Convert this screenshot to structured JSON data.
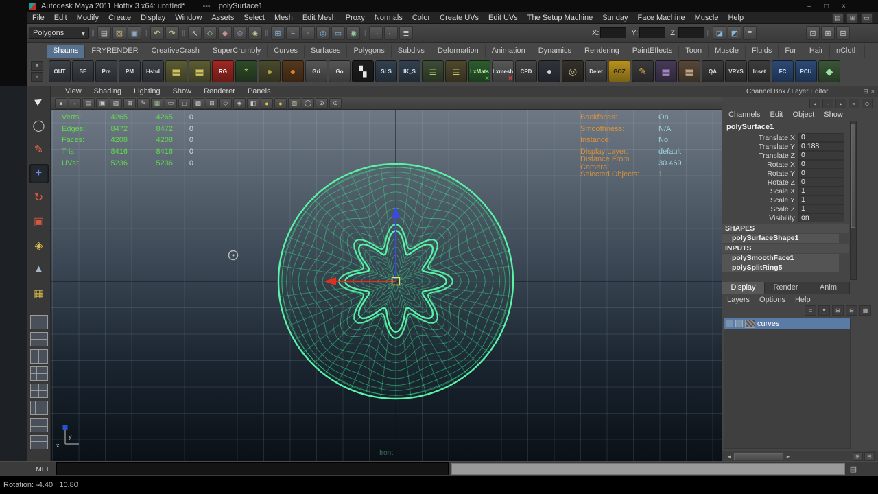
{
  "window": {
    "title": "Autodesk Maya 2011 Hotfix 3 x64: untitled*",
    "selection": "---    polySurface1",
    "controls": [
      {
        "name": "minimize-button",
        "glyph": "–"
      },
      {
        "name": "maximize-button",
        "glyph": "□"
      },
      {
        "name": "close-button",
        "glyph": "×"
      }
    ]
  },
  "menubar": {
    "items": [
      "File",
      "Edit",
      "Modify",
      "Create",
      "Display",
      "Window",
      "Assets",
      "Select",
      "Mesh",
      "Edit Mesh",
      "Proxy",
      "Normals",
      "Color",
      "Create UVs",
      "Edit UVs",
      "The Setup Machine",
      "Sunday",
      "Face Machine",
      "Muscle",
      "Help"
    ],
    "right_icons": [
      {
        "name": "toolbox-toggle-icon",
        "glyph": "▤",
        "color": "#b8b8b8"
      },
      {
        "name": "panel-layout-icon",
        "glyph": "⊞",
        "color": "#b8b8b8"
      },
      {
        "name": "help-line-toggle-icon",
        "glyph": "▭",
        "color": "#b8b8b8"
      }
    ]
  },
  "statusline": {
    "mode": "Polygons",
    "dropdown_arrow": "▾",
    "groups": [
      {
        "name": "scene-group",
        "icons": [
          {
            "name": "new-scene-icon",
            "glyph": "▤",
            "color": "#c8c8c8"
          },
          {
            "name": "open-scene-icon",
            "glyph": "▨",
            "color": "#c8b878"
          },
          {
            "name": "save-scene-icon",
            "glyph": "▣",
            "color": "#88a8c8"
          }
        ]
      },
      {
        "name": "undo-group",
        "icons": [
          {
            "name": "undo-icon",
            "glyph": "↶",
            "color": "#b8d890"
          },
          {
            "name": "redo-icon",
            "glyph": "↷",
            "color": "#b8d890"
          }
        ]
      },
      {
        "name": "selection-mask-group",
        "icons": [
          {
            "name": "select-hierarchy-icon",
            "glyph": "↖",
            "color": "#d8d8d8"
          },
          {
            "name": "select-object-icon",
            "glyph": "◇",
            "color": "#90c890"
          },
          {
            "name": "select-component-icon",
            "glyph": "◆",
            "color": "#c89090"
          },
          {
            "name": "select-by-type-icon",
            "glyph": "⊙",
            "color": "#9090c8"
          },
          {
            "name": "highlight-selection-icon",
            "glyph": "◈",
            "color": "#c8c890"
          }
        ]
      },
      {
        "name": "snap-group",
        "icons": [
          {
            "name": "snap-grid-icon",
            "glyph": "⊞",
            "color": "#7fb2e0"
          },
          {
            "name": "snap-curve-icon",
            "glyph": "≈",
            "color": "#7fb2e0"
          },
          {
            "name": "snap-point-icon",
            "glyph": "∙",
            "color": "#7fb2e0"
          },
          {
            "name": "snap-projected-center-icon",
            "glyph": "◎",
            "color": "#7fb2e0"
          },
          {
            "name": "snap-view-plane-icon",
            "glyph": "▭",
            "color": "#7fb2e0"
          },
          {
            "name": "make-live-icon",
            "glyph": "◉",
            "color": "#90c8a0"
          }
        ]
      },
      {
        "name": "history-group",
        "icons": [
          {
            "name": "input-connections-icon",
            "glyph": "→",
            "color": "#c8c8c8"
          },
          {
            "name": "output-connections-icon",
            "glyph": "←",
            "color": "#c8c8c8"
          },
          {
            "name": "construction-history-icon",
            "glyph": "≣",
            "color": "#c8c8c8"
          }
        ]
      }
    ],
    "coords": [
      {
        "name": "x-coordinate-field",
        "label": "X:"
      },
      {
        "name": "y-coordinate-field",
        "label": "Y:"
      },
      {
        "name": "z-coordinate-field",
        "label": "Z:"
      }
    ],
    "render_icons": [
      {
        "name": "render-current-frame-icon",
        "glyph": "◪",
        "color": "#88b8d8"
      },
      {
        "name": "ipr-render-icon",
        "glyph": "◩",
        "color": "#88b8d8"
      },
      {
        "name": "render-settings-icon",
        "glyph": "≡",
        "color": "#c8c8c8"
      }
    ],
    "right_icons": [
      {
        "name": "attribute-editor-toggle-icon",
        "glyph": "⊡",
        "color": "#c8c8c8"
      },
      {
        "name": "tool-settings-toggle-icon",
        "glyph": "⊞",
        "color": "#c8c8c8"
      },
      {
        "name": "channel-box-toggle-icon",
        "glyph": "⊟",
        "color": "#c8c8c8"
      }
    ]
  },
  "shelf": {
    "tabs": [
      "Shauns",
      "FRYRENDER",
      "CreativeCrash",
      "SuperCrumbly",
      "Curves",
      "Surfaces",
      "Polygons",
      "Subdivs",
      "Deformation",
      "Animation",
      "Dynamics",
      "Rendering",
      "PaintEffects",
      "Toon",
      "Muscle",
      "Fluids",
      "Fur",
      "Hair",
      "nCloth"
    ],
    "active_tab": "Shauns",
    "side_buttons": [
      {
        "name": "shelf-tab-switch-icon",
        "glyph": "▾"
      },
      {
        "name": "shelf-menu-icon",
        "glyph": "≡"
      }
    ],
    "items": [
      {
        "name": "shelf-out-button",
        "label": "OUT",
        "bg": "#3c4148",
        "fg": "#e0e0e0"
      },
      {
        "name": "shelf-se-button",
        "label": "SE",
        "bg": "#3c4148",
        "fg": "#e0e0e0"
      },
      {
        "name": "shelf-pre-button",
        "label": "Pre",
        "bg": "#3c4148",
        "fg": "#e0e0e0"
      },
      {
        "name": "shelf-pm-button",
        "label": "PM",
        "bg": "#3c4148",
        "fg": "#e0e0e0"
      },
      {
        "name": "shelf-hshd-button",
        "label": "Hshd",
        "bg": "#3c4148",
        "fg": "#e0e0e0"
      },
      {
        "name": "shelf-yellow-grid-button",
        "glyph": "▦",
        "bg": "#5c5c34",
        "fg": "#e6d66a"
      },
      {
        "name": "shelf-yellow-grid2-button",
        "glyph": "▦",
        "bg": "#5c5c34",
        "fg": "#e6d66a"
      },
      {
        "name": "shelf-rg-button",
        "label": "RG",
        "bg": "#9e2822",
        "fg": "#ffffff"
      },
      {
        "name": "shelf-bug-button",
        "glyph": "*",
        "bg": "#2f4a2a",
        "fg": "#86e24e"
      },
      {
        "name": "shelf-olive-button",
        "glyph": "●",
        "bg": "#4a4a2e",
        "fg": "#b2a242"
      },
      {
        "name": "shelf-orange-button",
        "glyph": "●",
        "bg": "#54381e",
        "fg": "#e07c22"
      },
      {
        "name": "shelf-gri-button",
        "label": "Gri",
        "bg": "#565656",
        "fg": "#dddddd"
      },
      {
        "name": "shelf-go-button",
        "label": "Go",
        "bg": "#565656",
        "fg": "#dddddd"
      },
      {
        "name": "shelf-checker-button",
        "glyph": "▚",
        "bg": "#1e1e1e",
        "fg": "#e8e8e8"
      },
      {
        "name": "shelf-sls-button",
        "label": "SLS",
        "bg": "#32404e",
        "fg": "#d2e2f0"
      },
      {
        "name": "shelf-iks-button",
        "label": "IK_S",
        "bg": "#32404e",
        "fg": "#d2e2f0"
      },
      {
        "name": "shelf-stack-green-button",
        "glyph": "≣",
        "bg": "#3c4c36",
        "fg": "#a2d05c"
      },
      {
        "name": "shelf-stack-yellow-button",
        "glyph": "≣",
        "bg": "#4e482e",
        "fg": "#d0c45c"
      },
      {
        "name": "shelf-lxmats-button",
        "label": "LxMats",
        "bg": "#2e5c2e",
        "fg": "#b6f0a6",
        "badge": "×",
        "badge_color": "#52d052"
      },
      {
        "name": "shelf-lxmesh-button",
        "label": "Lxmesh",
        "bg": "#585858",
        "fg": "#eeeeee",
        "badge": "×",
        "badge_color": "#e04040"
      },
      {
        "name": "shelf-cpd-button",
        "label": "CPD",
        "bg": "#454545",
        "fg": "#dddddd"
      },
      {
        "name": "shelf-pearl-button",
        "glyph": "●",
        "bg": "#30343a",
        "fg": "#c6d6e6"
      },
      {
        "name": "shelf-ring-button",
        "glyph": "◎",
        "bg": "#34302a",
        "fg": "#d8c8a0"
      },
      {
        "name": "shelf-delete-button",
        "label": "Delet",
        "bg": "#4a4a4a",
        "fg": "#dddddd"
      },
      {
        "name": "shelf-goz-button",
        "label": "GOZ",
        "bg": "#b8921e",
        "fg": "#1e1e1e"
      },
      {
        "name": "shelf-pencil-button",
        "glyph": "✎",
        "bg": "#3a3a3a",
        "fg": "#e0b050"
      },
      {
        "name": "shelf-purple-grid-button",
        "glyph": "▦",
        "bg": "#463a56",
        "fg": "#b494d8"
      },
      {
        "name": "shelf-tan-grid-button",
        "glyph": "▦",
        "bg": "#564838",
        "fg": "#d4b48c"
      },
      {
        "name": "shelf-qa-button",
        "label": "QA",
        "bg": "#3c3c3c",
        "fg": "#dddddd"
      },
      {
        "name": "shelf-vrys-button",
        "label": "VRYS",
        "bg": "#3c3c3c",
        "fg": "#dddddd"
      },
      {
        "name": "shelf-inset-button",
        "label": "Inset",
        "bg": "#3c3c3c",
        "fg": "#dddddd"
      },
      {
        "name": "shelf-fc-button",
        "label": "FC",
        "bg": "#2c4a76",
        "fg": "#cfe4f4"
      },
      {
        "name": "shelf-pcu-button",
        "label": "PCU",
        "bg": "#2c4a76",
        "fg": "#cfe4f4"
      },
      {
        "name": "shelf-wrench-button",
        "glyph": "◆",
        "bg": "#3a5638",
        "fg": "#9ee09e"
      }
    ]
  },
  "toolbox": {
    "tools": [
      {
        "name": "select-tool",
        "glyph": "►",
        "color": "#e8e8e8",
        "rotate": -30
      },
      {
        "name": "lasso-tool",
        "glyph": "◯",
        "color": "#c8c8c8"
      },
      {
        "name": "paint-selection-tool",
        "glyph": "✎",
        "color": "#e06a50"
      },
      {
        "name": "move-tool",
        "glyph": "+",
        "color": "#6a8af0",
        "active": true
      },
      {
        "name": "rotate-tool",
        "glyph": "↻",
        "color": "#e05a40"
      },
      {
        "name": "scale-tool",
        "glyph": "▣",
        "color": "#d05a40"
      },
      {
        "name": "universal-manipulator-tool",
        "glyph": "◈",
        "color": "#d8c050"
      },
      {
        "name": "soft-modification-tool",
        "glyph": "▲",
        "color": "#a8b8c8"
      },
      {
        "name": "custom-grid-tool",
        "glyph": "▦",
        "color": "#cdb54a"
      }
    ],
    "layouts": [
      "single-pane-layout",
      "two-panes-stacked-layout",
      "two-panes-side-layout",
      "three-panes-left-layout",
      "four-panes-layout",
      "outliner-persp-layout",
      "graph-persp-layout",
      "hypershade-persp-layout"
    ]
  },
  "viewport": {
    "menu": [
      "View",
      "Shading",
      "Lighting",
      "Show",
      "Renderer",
      "Panels"
    ],
    "toolbar_icons": [
      {
        "name": "select-camera-icon",
        "glyph": "▴",
        "color": "#c8c8c8"
      },
      {
        "name": "lock-camera-icon",
        "glyph": "◦",
        "color": "#c8c8c8"
      },
      {
        "name": "camera-attributes-icon",
        "glyph": "▤",
        "color": "#c8c8c8"
      },
      {
        "name": "bookmark-icon",
        "glyph": "▣",
        "color": "#c8c8c8"
      },
      {
        "name": "image-plane-icon",
        "glyph": "▨",
        "color": "#c8c8c8"
      },
      {
        "name": "two-d-pan-zoom-icon",
        "glyph": "⊞",
        "color": "#c8c8c8"
      },
      {
        "name": "grease-pencil-icon",
        "glyph": "✎",
        "color": "#c8c8c8"
      },
      {
        "name": "grid-icon",
        "glyph": "▦",
        "color": "#9fc09f"
      },
      {
        "name": "film-gate-icon",
        "glyph": "▭",
        "color": "#c8c8c8"
      },
      {
        "name": "resolution-gate-icon",
        "glyph": "□",
        "color": "#c8c8c8"
      },
      {
        "name": "gate-mask-icon",
        "glyph": "▩",
        "color": "#c8c8c8"
      },
      {
        "name": "field-chart-icon",
        "glyph": "⊟",
        "color": "#c8c8c8"
      },
      {
        "name": "safe-action-icon",
        "glyph": "◇",
        "color": "#c8c8c8"
      },
      {
        "name": "safe-title-icon",
        "glyph": "◈",
        "color": "#c8c8c8"
      },
      {
        "name": "fill-mode-icon",
        "glyph": "◧",
        "color": "#c8c8c8"
      },
      {
        "name": "default-light-icon",
        "glyph": "●",
        "color": "#e0c83c"
      },
      {
        "name": "shaded-mode-icon",
        "glyph": "●",
        "color": "#e0c83c"
      },
      {
        "name": "textured-mode-icon",
        "glyph": "▨",
        "color": "#b8c8a0"
      },
      {
        "name": "wireframe-mode-icon",
        "glyph": "◯",
        "color": "#c8c8c8"
      },
      {
        "name": "xray-mode-icon",
        "glyph": "⊘",
        "color": "#c8c8c8"
      },
      {
        "name": "isolate-select-icon",
        "glyph": "⊙",
        "color": "#c8c8c8"
      }
    ],
    "camera_label": "front",
    "hud_left": [
      {
        "label": "Verts:",
        "total": "4265",
        "sel": "4265",
        "extra": "0"
      },
      {
        "label": "Edges:",
        "total": "8472",
        "sel": "8472",
        "extra": "0"
      },
      {
        "label": "Faces:",
        "total": "4208",
        "sel": "4208",
        "extra": "0"
      },
      {
        "label": "Tris:",
        "total": "8416",
        "sel": "8416",
        "extra": "0"
      },
      {
        "label": "UVs:",
        "total": "5236",
        "sel": "5236",
        "extra": "0"
      }
    ],
    "hud_right": [
      {
        "label": "Backfaces:",
        "value": "On"
      },
      {
        "label": "Smoothness:",
        "value": "N/A"
      },
      {
        "label": "Instance:",
        "value": "No"
      },
      {
        "label": "Display Layer:",
        "value": "default"
      },
      {
        "label": "Distance From Camera:",
        "value": "30.469"
      },
      {
        "label": "Selected Objects:",
        "value": "1"
      }
    ],
    "axis_labels": {
      "x": "x",
      "y": "y"
    }
  },
  "channel_box": {
    "title": "Channel Box / Layer Editor",
    "title_icons": [
      {
        "name": "collapse-panel-icon",
        "glyph": "⊟"
      },
      {
        "name": "close-panel-icon",
        "glyph": "×"
      }
    ],
    "icon_row": [
      {
        "name": "slow-speed-icon",
        "glyph": "◂"
      },
      {
        "name": "medium-speed-icon",
        "glyph": "∙"
      },
      {
        "name": "fast-speed-icon",
        "glyph": "▸"
      },
      {
        "name": "hyperbolic-curve-icon",
        "glyph": "≈"
      },
      {
        "name": "pin-channel-icon",
        "glyph": "⊙"
      }
    ],
    "menus": [
      "Channels",
      "Edit",
      "Object",
      "Show"
    ],
    "object": "polySurface1",
    "attributes": [
      {
        "name": "Translate X",
        "value": "0"
      },
      {
        "name": "Translate Y",
        "value": "0.188"
      },
      {
        "name": "Translate Z",
        "value": "0"
      },
      {
        "name": "Rotate X",
        "value": "0"
      },
      {
        "name": "Rotate Y",
        "value": "0"
      },
      {
        "name": "Rotate Z",
        "value": "0"
      },
      {
        "name": "Scale X",
        "value": "1"
      },
      {
        "name": "Scale Y",
        "value": "1"
      },
      {
        "name": "Scale Z",
        "value": "1"
      },
      {
        "name": "Visibility",
        "value": "on"
      }
    ],
    "sections": [
      {
        "header": "SHAPES",
        "items": [
          "polySurfaceShape1"
        ]
      },
      {
        "header": "INPUTS",
        "items": [
          "polySmoothFace1",
          "polySplitRing5"
        ]
      }
    ]
  },
  "layer_editor": {
    "tabs": [
      "Display",
      "Render",
      "Anim"
    ],
    "active_tab": "Display",
    "menus": [
      "Layers",
      "Options",
      "Help"
    ],
    "icons": [
      {
        "name": "layers-stack-icon",
        "glyph": "≣"
      },
      {
        "name": "layer-options-icon",
        "glyph": "▾"
      },
      {
        "name": "new-scene-layer-icon",
        "glyph": "⊞"
      },
      {
        "name": "new-selected-layer-icon",
        "glyph": "⊟"
      },
      {
        "name": "new-empty-layer-icon",
        "glyph": "▦"
      }
    ],
    "layers": [
      {
        "name": "curves",
        "selected": true
      }
    ]
  },
  "command_line": {
    "label": "MEL",
    "script_editor_icon": "▤"
  },
  "help_line": {
    "text": "Rotation: -4.40   10.80"
  },
  "colors": {
    "wireframe": "#3fe193",
    "wireframe_bright": "#5af2a8",
    "hud_green": "#62d84e",
    "hud_extra": "#d8d8d8",
    "hud_orange": "#d8913c",
    "hud_value": "#9fd3dc",
    "manip_x": "#e03020",
    "manip_y": "#3a4ae0",
    "manip_center": "#e6e65a",
    "selection_blue": "#5a7ba6"
  }
}
